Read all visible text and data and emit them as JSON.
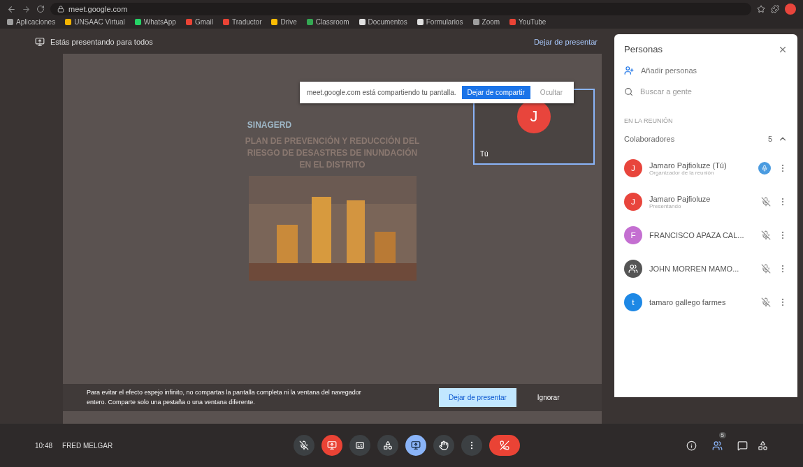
{
  "browser": {
    "url": "meet.google.com",
    "bookmarks": [
      {
        "label": "Aplicaciones",
        "color": "#9e9e9e"
      },
      {
        "label": "UNSAAC Virtual",
        "color": "#f4b400"
      },
      {
        "label": "WhatsApp",
        "color": "#25d366"
      },
      {
        "label": "Gmail",
        "color": "#ea4335"
      },
      {
        "label": "Traductor",
        "color": "#ea4335"
      },
      {
        "label": "Drive",
        "color": "#fbbc04"
      },
      {
        "label": "Classroom",
        "color": "#34a853"
      },
      {
        "label": "Documentos",
        "color": "#e0e0e0"
      },
      {
        "label": "Formularios",
        "color": "#e0e0e0"
      },
      {
        "label": "Zoom",
        "color": "#9e9e9e"
      },
      {
        "label": "YouTube",
        "color": "#ea4335"
      }
    ]
  },
  "presenting": {
    "label": "Estás presentando para todos",
    "stop": "Dejar de presentar"
  },
  "share_bar": {
    "message": "meet.google.com está compartiendo tu pantalla.",
    "stop": "Dejar de compartir",
    "hide": "Ocultar"
  },
  "self_tile": {
    "initial": "J",
    "name": "Tú"
  },
  "slide": {
    "title": "PLAN DE PREVENCIÓN Y REDUCCIÓN DEL RIESGO DE DESASTRES DE INUNDACIÓN EN EL DISTRITO",
    "logo": "SINAGERD",
    "kind": "picture"
  },
  "warning": {
    "message": "Para evitar el efecto espejo infinito, no compartas la pantalla completa ni la ventana del navegador entero. Comparte solo una pestaña o una ventana diferente.",
    "stop": "Dejar de presentar",
    "ignore": "Ignorar"
  },
  "people_panel": {
    "title": "Personas",
    "add": "Añadir personas",
    "search_placeholder": "Buscar a gente",
    "section": "EN LA REUNIÓN",
    "group": {
      "label": "Colaboradores",
      "count": "5",
      "expanded": true
    },
    "participants": [
      {
        "name": "Jamaro Pajfioluze (Tú)",
        "subtitle": "Organizador de la reunión",
        "initial": "J",
        "color": "#e8453c",
        "speaking": true
      },
      {
        "name": "Jamaro Pajfioluze",
        "subtitle": "Presentando",
        "initial": "J",
        "color": "#e8453c",
        "speaking": false
      },
      {
        "name": "FRANCISCO APAZA CAL...",
        "initial": "F",
        "color": "#c46fd1",
        "speaking": false
      },
      {
        "name": "JOHN MORREN MAMO...",
        "color": "#555555",
        "speaking": false
      },
      {
        "name": "tamaro gallego farmes",
        "initial": "t",
        "color": "#1e88e5",
        "speaking": false
      }
    ]
  },
  "bottom_bar": {
    "time": "10:48",
    "meeting": "FRED MELGAR",
    "people_count": "5"
  }
}
